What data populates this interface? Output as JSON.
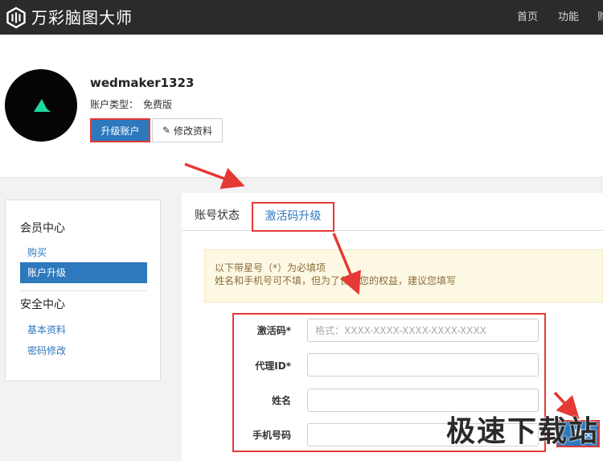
{
  "app": {
    "brand": "万彩脑图大师",
    "nav": [
      "首页",
      "功能",
      "购"
    ]
  },
  "profile": {
    "username": "wedmaker1323",
    "account_type_label": "账户类型：",
    "account_type_value": "免费版",
    "upgrade_button": "升级账户",
    "edit_button": "修改资料",
    "edit_icon": "edit-icon"
  },
  "sidebar": {
    "member_center": "会员中心",
    "buy": "购买",
    "account_upgrade": "账户升级",
    "security_center": "安全中心",
    "basic_info": "基本资料",
    "password_change": "密码修改"
  },
  "tabs": {
    "account_status": "账号状态",
    "activation_upgrade": "激活码升级"
  },
  "notice": {
    "line1": "以下带星号（*）为必填项",
    "line2": "姓名和手机号可不填，但为了保障您的权益，建议您填写"
  },
  "form": {
    "activation_code_label": "激活码*",
    "activation_code_placeholder": "格式：XXXX-XXXX-XXXX-XXXX-XXXX",
    "agent_id_label": "代理ID*",
    "name_label": "姓名",
    "phone_label": "手机号码",
    "submit_button": "提交"
  },
  "watermark": "极速下载站",
  "colors": {
    "navbar": "#2b2b2b",
    "primary": "#2e78bd",
    "highlight": "#e53935",
    "logo_triangle": "#1dd9a0",
    "notice_bg": "#fdf8e4",
    "notice_text": "#8a6d3b"
  }
}
